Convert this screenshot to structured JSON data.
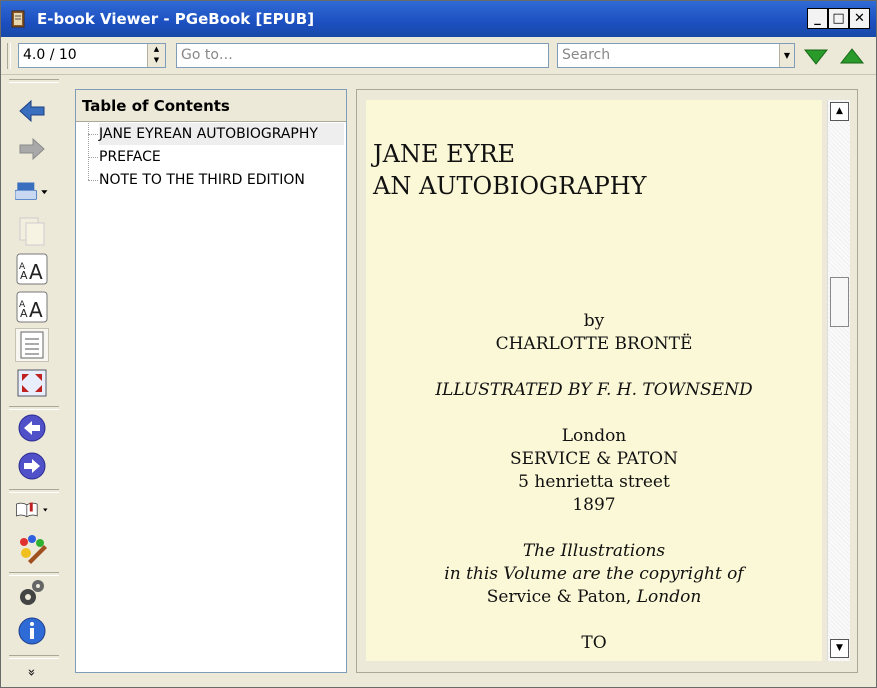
{
  "window": {
    "title": "E-book Viewer - PGeBook [EPUB]",
    "controls": {
      "minimize": "_",
      "maximize": "□",
      "close": "✕"
    }
  },
  "toolbar": {
    "position_value": "4.0 / 10",
    "goto_placeholder": "Go to…",
    "search_placeholder": "Search",
    "find_next_icon": "down-triangle-icon",
    "find_prev_icon": "up-triangle-icon"
  },
  "sidebar": {
    "buttons": [
      {
        "name": "back-icon"
      },
      {
        "name": "forward-icon"
      },
      {
        "name": "print-icon"
      },
      {
        "name": "copy-icon"
      },
      {
        "name": "font-larger-icon"
      },
      {
        "name": "font-smaller-icon"
      },
      {
        "name": "toc-icon"
      },
      {
        "name": "fullscreen-icon"
      },
      {
        "name": "previous-page-icon"
      },
      {
        "name": "next-page-icon"
      },
      {
        "name": "bookmarks-icon"
      },
      {
        "name": "theme-icon"
      },
      {
        "name": "preferences-icon"
      },
      {
        "name": "info-icon"
      },
      {
        "name": "more-icon"
      }
    ],
    "more_label": "»"
  },
  "toc": {
    "header": "Table of Contents",
    "items": [
      {
        "label": "JANE EYREAN AUTOBIOGRAPHY",
        "selected": true
      },
      {
        "label": "PREFACE",
        "selected": false
      },
      {
        "label": "NOTE TO THE THIRD EDITION",
        "selected": false
      }
    ]
  },
  "page": {
    "title_line1": "JANE EYRE",
    "title_line2": "AN AUTOBIOGRAPHY",
    "by": "by",
    "author": "CHARLOTTE BRONTË",
    "illustrated": "ILLUSTRATED BY F. H. TOWNSEND",
    "city": "London",
    "publisher": "SERVICE & PATON",
    "street": "5 henrietta street",
    "year": "1897",
    "note1": "The Illustrations",
    "note2": "in this Volume are the copyright of",
    "note3a": "Service & Paton, ",
    "note3b": "London",
    "to": "TO"
  },
  "colors": {
    "titlebar": "#1c4fc0",
    "page_bg": "#fbf8d7",
    "arrow_green": "#2a9a2a",
    "nav_blue": "#5050c8"
  }
}
